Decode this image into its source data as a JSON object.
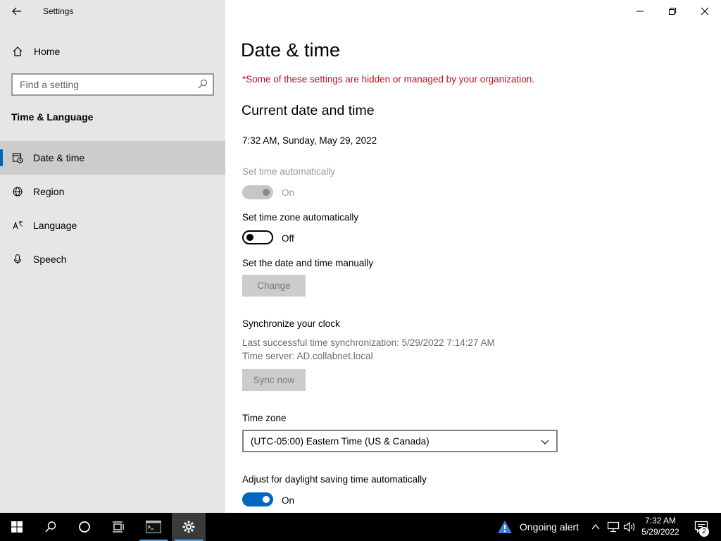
{
  "app": {
    "title": "Settings"
  },
  "sidebar": {
    "home_label": "Home",
    "search_placeholder": "Find a setting",
    "section_title": "Time & Language",
    "items": [
      {
        "label": "Date & time",
        "icon": "calendar-clock-icon",
        "selected": true
      },
      {
        "label": "Region",
        "icon": "globe-icon",
        "selected": false
      },
      {
        "label": "Language",
        "icon": "language-icon",
        "selected": false
      },
      {
        "label": "Speech",
        "icon": "microphone-icon",
        "selected": false
      }
    ]
  },
  "main": {
    "title": "Date & time",
    "managed_warning": "*Some of these settings are hidden or managed by your organization.",
    "current_heading": "Current date and time",
    "current_value": "7:32 AM, Sunday, May 29, 2022",
    "set_time_auto": {
      "label": "Set time automatically",
      "state": "On",
      "enabled": false
    },
    "set_tz_auto": {
      "label": "Set time zone automatically",
      "state": "Off",
      "enabled": true
    },
    "manual": {
      "label": "Set the date and time manually",
      "button": "Change"
    },
    "sync": {
      "heading": "Synchronize your clock",
      "last_sync": "Last successful time synchronization: 5/29/2022 7:14:27 AM",
      "server": "Time server: AD.collabnet.local",
      "button": "Sync now"
    },
    "timezone": {
      "label": "Time zone",
      "value": "(UTC-05:00) Eastern Time (US & Canada)"
    },
    "dst": {
      "label": "Adjust for daylight saving time automatically",
      "state": "On"
    }
  },
  "taskbar": {
    "alert_text": "Ongoing alert",
    "time": "7:32 AM",
    "date": "5/29/2022",
    "notification_count": "2"
  },
  "colors": {
    "accent": "#0067c0",
    "warning": "#c50f1f",
    "sidebar_bg": "#e6e6e6",
    "taskbar_bg": "#000000"
  }
}
